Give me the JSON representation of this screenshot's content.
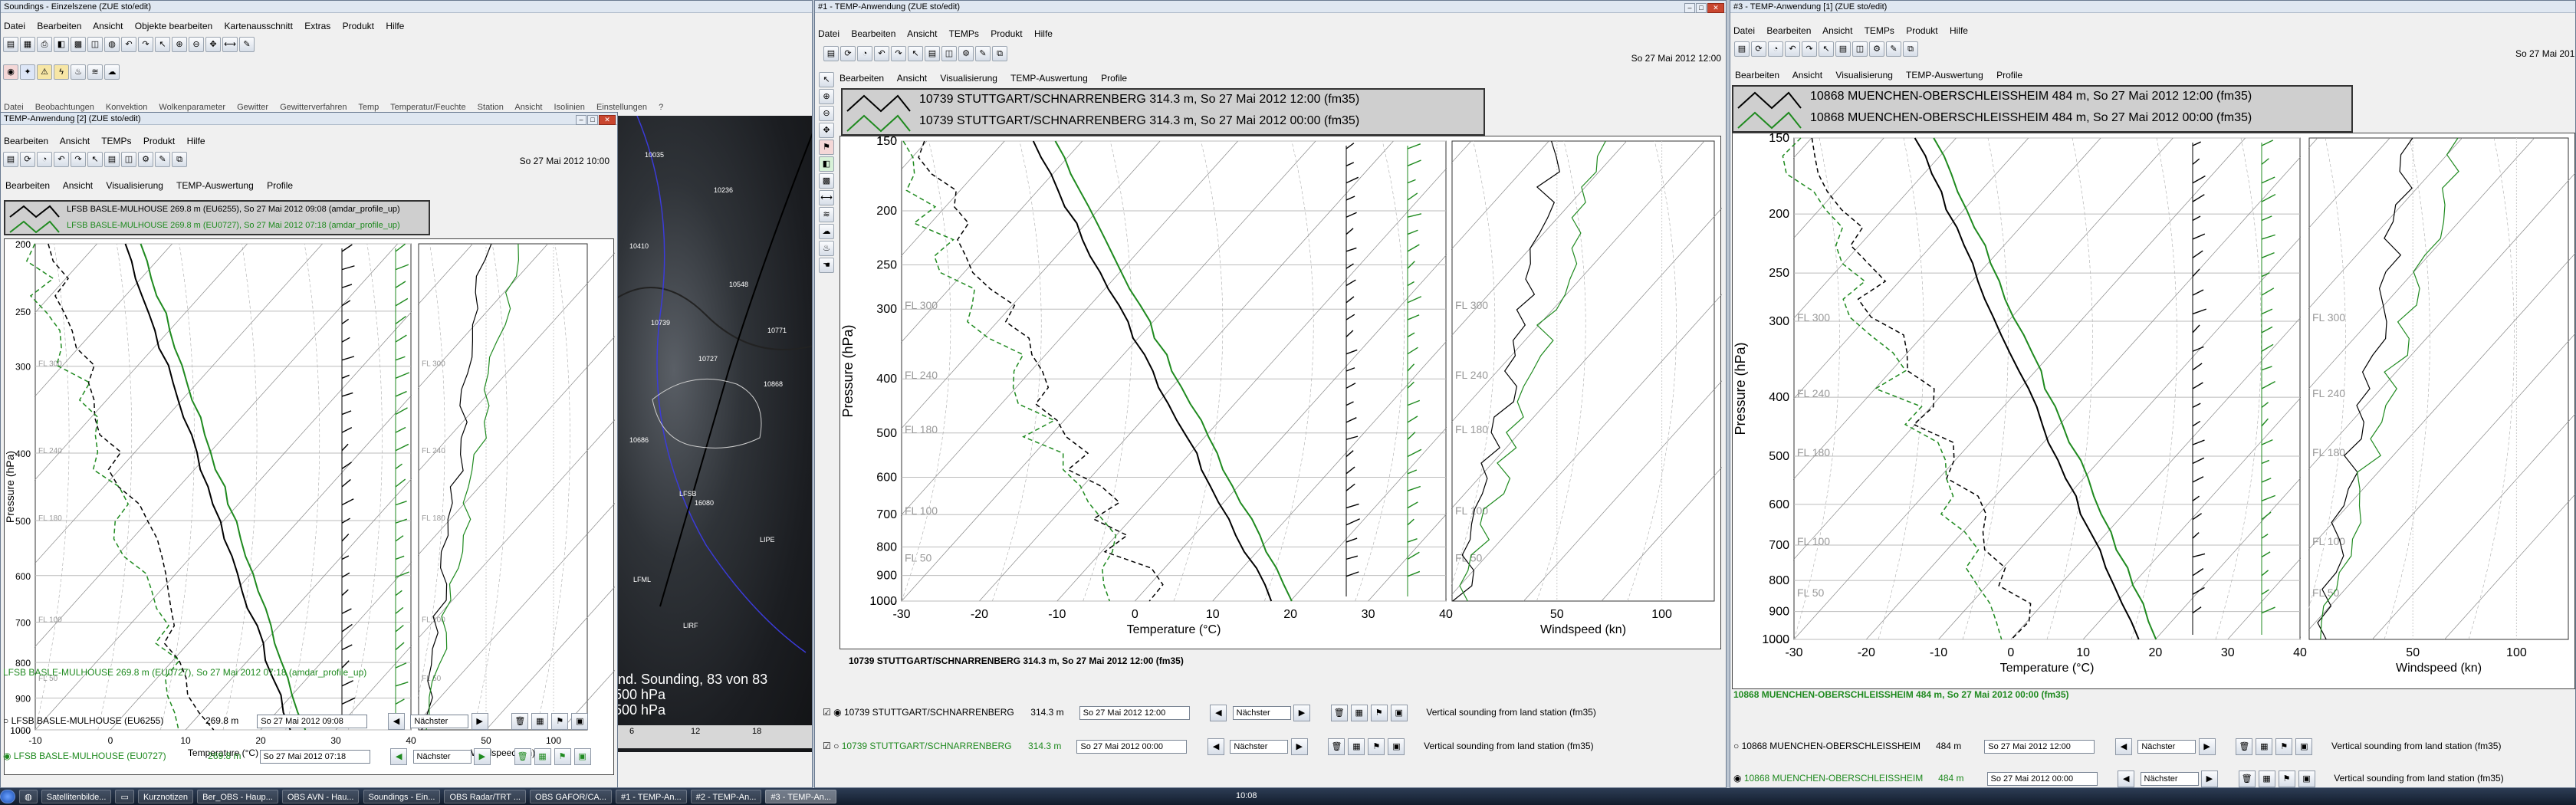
{
  "main": {
    "title": "Soundings - Einzelszene (ZUE sto/edit)",
    "menu": [
      "Datei",
      "Bearbeiten",
      "Ansicht",
      "Objekte bearbeiten",
      "Kartenausschnitt",
      "Extras",
      "Produkt",
      "Hilfe"
    ],
    "menu2": [
      "Datei",
      "Beobachtungen",
      "Konvektion",
      "Wolkenparameter",
      "Gewitter",
      "Gewitterverfahren",
      "Temp",
      "Temperatur/Feuchte",
      "Station",
      "Ansicht",
      "Isolinien",
      "Einstellungen",
      "?"
    ],
    "map_text": {
      "stations": [
        "10035",
        "10236",
        "10410",
        "10548",
        "10771",
        "10868",
        "10739",
        "10727",
        "10686",
        "LFSB",
        "16080",
        "LIPE",
        "LFML",
        "LIRF"
      ],
      "overlay_line1": "Ind. Sounding, 83 von 83",
      "overlay_line2": "500 hPa",
      "overlay_line3": "500 hPa",
      "timeline": [
        "6",
        "12",
        "18"
      ]
    }
  },
  "w1": {
    "title": "TEMP-Anwendung [2] (ZUE sto/edit)",
    "menu": [
      "Bearbeiten",
      "Ansicht",
      "TEMPs",
      "Produkt",
      "Hilfe"
    ],
    "datetime": "So 27 Mai 2012 10:00",
    "tabs": [
      "Bearbeiten",
      "Ansicht",
      "Visualisierung",
      "TEMP-Auswertung",
      "Profile"
    ],
    "legend": [
      "LFSB BASLE-MULHOUSE 269.8 m (EU6255), So 27 Mai 2012 09:08 (amdar_profile_up)",
      "LFSB BASLE-MULHOUSE 269.8 m (EU0727), So 27 Mai 2012 07:18 (amdar_profile_up)"
    ],
    "ylabel": "Pressure (hPa)",
    "xlabel": "Temperature (°C)",
    "xlabel2": "Windspeed (kn)",
    "pticks": [
      "200",
      "250",
      "300",
      "400",
      "500",
      "600",
      "700",
      "800",
      "900",
      "1000"
    ],
    "tticks": [
      "-10",
      "0",
      "10",
      "20",
      "30",
      "40"
    ],
    "wticks": [
      "50",
      "100"
    ],
    "fl": [
      "FL 300",
      "FL 240",
      "FL 180",
      "FL 100",
      "FL 50"
    ],
    "status": "LFSB BASLE-MULHOUSE 269.8 m (EU0727), So 27 Mai 2012 07:18 (amdar_profile_up)",
    "rows": [
      {
        "name": "LFSB BASLE-MULHOUSE (EU6255)",
        "alt": "269.8 m",
        "date": "So 27 Mai 2012 09:08",
        "next": "Nächster"
      },
      {
        "name": "LFSB BASLE-MULHOUSE (EU0727)",
        "alt": "269.8 m",
        "date": "So 27 Mai 2012 07:18",
        "next": "Nächster"
      }
    ]
  },
  "w2": {
    "title": "#1 - TEMP-Anwendung (ZUE sto/edit)",
    "menu": [
      "Datei",
      "Bearbeiten",
      "Ansicht",
      "TEMPs",
      "Produkt",
      "Hilfe"
    ],
    "datetime": "So 27 Mai 2012 12:00",
    "tabs": [
      "Bearbeiten",
      "Ansicht",
      "Visualisierung",
      "TEMP-Auswertung",
      "Profile"
    ],
    "legend": [
      "10739 STUTTGART/SCHNARRENBERG 314.3 m, So 27 Mai 2012 12:00 (fm35)",
      "10739 STUTTGART/SCHNARRENBERG 314.3 m, So 27 Mai 2012 00:00 (fm35)"
    ],
    "ylabel": "Pressure (hPa)",
    "xlabel": "Temperature (°C)",
    "xlabel2": "Windspeed (kn)",
    "pticks": [
      "150",
      "200",
      "250",
      "300",
      "400",
      "500",
      "600",
      "700",
      "800",
      "900",
      "1000"
    ],
    "tticks": [
      "-30",
      "-20",
      "-10",
      "0",
      "10",
      "20",
      "30",
      "40"
    ],
    "wticks": [
      "50",
      "100"
    ],
    "fl": [
      "FL 300",
      "FL 240",
      "FL 180",
      "FL 100",
      "FL 50"
    ],
    "status": "10739 STUTTGART/SCHNARRENBERG 314.3 m, So 27 Mai 2012 12:00 (fm35)",
    "rows": [
      {
        "name": "10739 STUTTGART/SCHNARRENBERG",
        "alt": "314.3 m",
        "date": "So 27 Mai 2012 12:00",
        "next": "Nächster",
        "desc": "Vertical sounding from land station (fm35)"
      },
      {
        "name": "10739 STUTTGART/SCHNARRENBERG",
        "alt": "314.3 m",
        "date": "So 27 Mai 2012 00:00",
        "next": "Nächster",
        "desc": "Vertical sounding from land station (fm35)"
      }
    ]
  },
  "w3": {
    "title": "#3 - TEMP-Anwendung [1] (ZUE sto/edit)",
    "menu": [
      "Datei",
      "Bearbeiten",
      "Ansicht",
      "TEMPs",
      "Produkt",
      "Hilfe"
    ],
    "datetime": "So 27 Mai 2012 12:00",
    "tabs": [
      "Bearbeiten",
      "Ansicht",
      "Visualisierung",
      "TEMP-Auswertung",
      "Profile"
    ],
    "legend": [
      "10868 MUENCHEN-OBERSCHLEISSHEIM 484 m, So 27 Mai 2012 12:00 (fm35)",
      "10868 MUENCHEN-OBERSCHLEISSHEIM 484 m, So 27 Mai 2012 00:00 (fm35)"
    ],
    "ylabel": "Pressure (hPa)",
    "xlabel": "Temperature (°C)",
    "xlabel2": "Windspeed (kn)",
    "pticks": [
      "150",
      "200",
      "250",
      "300",
      "400",
      "500",
      "600",
      "700",
      "800",
      "900",
      "1000"
    ],
    "tticks": [
      "-30",
      "-20",
      "-10",
      "0",
      "10",
      "20",
      "30",
      "40"
    ],
    "wticks": [
      "50",
      "100"
    ],
    "fl": [
      "FL 300",
      "FL 240",
      "FL 180",
      "FL 100",
      "FL 50"
    ],
    "status": "10868 MUENCHEN-OBERSCHLEISSHEIM 484 m, So 27 Mai 2012 00:00 (fm35)",
    "rows": [
      {
        "name": "10868 MUENCHEN-OBERSCHLEISSHEIM",
        "alt": "484 m",
        "date": "So 27 Mai 2012 12:00",
        "next": "Nächster",
        "desc": "Vertical sounding from land station (fm35)"
      },
      {
        "name": "10868 MUENCHEN-OBERSCHLEISSHEIM",
        "alt": "484 m",
        "date": "So 27 Mai 2012 00:00",
        "next": "Nächster",
        "desc": "Vertical sounding from land station (fm35)"
      }
    ]
  },
  "taskbar": {
    "items": [
      "Satellitenbilde...",
      "Kurznotizen",
      "Ber_OBS - Haup...",
      "OBS AVN - Hau...",
      "Soundings - Ein...",
      "OBS Radar/TRT ...",
      "OBS GAFOR/CA...",
      "#1 - TEMP-An...",
      "#2 - TEMP-An...",
      "#3 - TEMP-An..."
    ],
    "clock": "10:08"
  }
}
